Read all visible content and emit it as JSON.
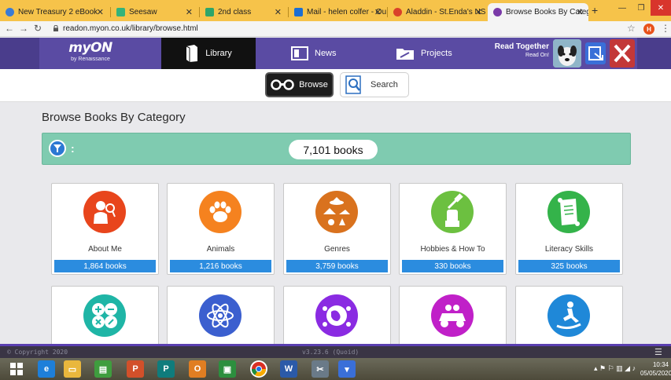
{
  "browser": {
    "tabs": [
      {
        "label": "New Treasury 2 eBook",
        "color": "#3a7bd5"
      },
      {
        "label": "Seesaw",
        "color": "#34b37a"
      },
      {
        "label": "2nd class",
        "color": "#2ea56a"
      },
      {
        "label": "Mail - helen colfer - Out",
        "color": "#1b6ed3"
      },
      {
        "label": "Aladdin - St.Enda's NS -",
        "color": "#d9412a"
      },
      {
        "label": "Browse Books By Catego",
        "color": "#7a3aa8"
      }
    ],
    "url": "readon.myon.co.uk/library/browse.html",
    "profile_initial": "H"
  },
  "nav": {
    "logo": "myON",
    "logo_sub": "by Renaissance",
    "library": "Library",
    "news": "News",
    "projects": "Projects",
    "read_together": "Read Together",
    "read_on": "Read On!"
  },
  "toggle": {
    "browse": "Browse",
    "search": "Search"
  },
  "main": {
    "title": "Browse Books By Category",
    "filter_dots": ":",
    "book_count": "7,101 books"
  },
  "categories": [
    {
      "name": "About Me",
      "count": "1,864 books",
      "color": "#e8451c"
    },
    {
      "name": "Animals",
      "count": "1,216 books",
      "color": "#f5821f"
    },
    {
      "name": "Genres",
      "count": "3,759 books",
      "color": "#d9721e"
    },
    {
      "name": "Hobbies & How To",
      "count": "330 books",
      "color": "#6cc040"
    },
    {
      "name": "Literacy Skills",
      "count": "325 books",
      "color": "#34b34a"
    },
    {
      "name": "",
      "count": "",
      "color": "#1fb5a6"
    },
    {
      "name": "",
      "count": "",
      "color": "#3b5fcf"
    },
    {
      "name": "",
      "count": "",
      "color": "#8a2be2"
    },
    {
      "name": "",
      "count": "",
      "color": "#c020c8"
    },
    {
      "name": "",
      "count": "",
      "color": "#1f88d8"
    }
  ],
  "footer": {
    "copyright": "© Copyright 2020",
    "version": "v3.23.6 (Quoid)"
  },
  "taskbar": {
    "time": "10:34",
    "date": "05/05/2020"
  }
}
